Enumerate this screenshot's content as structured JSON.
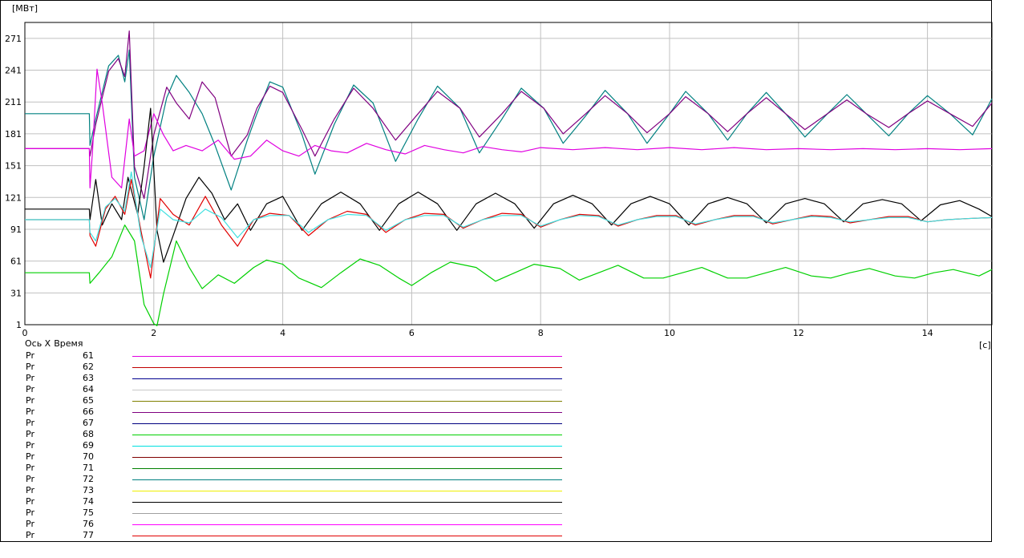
{
  "chart_data": {
    "type": "line",
    "ylabel": "[МВт]",
    "xlabel": "[с]",
    "xlim": [
      0,
      15
    ],
    "ylim": [
      1,
      286
    ],
    "y_ticks": [
      "271",
      "241",
      "211",
      "181",
      "151",
      "121",
      "91",
      "61",
      "31",
      "1"
    ],
    "y_tick_values": [
      271,
      241,
      211,
      181,
      151,
      121,
      91,
      61,
      31,
      1
    ],
    "x_ticks": [
      "0",
      "2",
      "4",
      "6",
      "8",
      "10",
      "12",
      "14"
    ],
    "x_tick_values": [
      0,
      2,
      4,
      6,
      8,
      10,
      12,
      14
    ],
    "grid": true,
    "legend_header": {
      "axis": "Ось X",
      "name": "Время"
    },
    "legend": [
      {
        "var": "Pr",
        "num": "61",
        "color": "#e000e0"
      },
      {
        "var": "Pr",
        "num": "62",
        "color": "#c00000"
      },
      {
        "var": "Pr",
        "num": "63",
        "color": "#000090"
      },
      {
        "var": "Pr",
        "num": "64",
        "color": "#c8c8c8"
      },
      {
        "var": "Pr",
        "num": "65",
        "color": "#808000"
      },
      {
        "var": "Pr",
        "num": "66",
        "color": "#800080"
      },
      {
        "var": "Pr",
        "num": "67",
        "color": "#000080"
      },
      {
        "var": "Pr",
        "num": "68",
        "color": "#00d000"
      },
      {
        "var": "Pr",
        "num": "69",
        "color": "#00e0e0"
      },
      {
        "var": "Pr",
        "num": "70",
        "color": "#800000"
      },
      {
        "var": "Pr",
        "num": "71",
        "color": "#008000"
      },
      {
        "var": "Pr",
        "num": "72",
        "color": "#008080"
      },
      {
        "var": "Pr",
        "num": "73",
        "color": "#f0f000"
      },
      {
        "var": "Pr",
        "num": "74",
        "color": "#000000"
      },
      {
        "var": "Pr",
        "num": "75",
        "color": "#a0a0a0"
      },
      {
        "var": "Pr",
        "num": "76",
        "color": "#ff00ff"
      },
      {
        "var": "Pr",
        "num": "77",
        "color": "#e00000"
      }
    ],
    "series": [
      {
        "color": "#008080",
        "x": [
          0,
          1,
          1.01,
          1.1,
          1.3,
          1.45,
          1.55,
          1.62,
          1.7,
          1.85,
          2.0,
          2.2,
          2.35,
          2.55,
          2.75,
          2.95,
          3.2,
          3.45,
          3.6,
          3.8,
          4.0,
          4.3,
          4.5,
          4.8,
          5.1,
          5.4,
          5.75,
          6.1,
          6.4,
          6.75,
          7.05,
          7.4,
          7.7,
          8.05,
          8.35,
          8.7,
          9.0,
          9.35,
          9.65,
          10.0,
          10.25,
          10.6,
          10.9,
          11.2,
          11.5,
          11.8,
          12.1,
          12.45,
          12.75,
          13.05,
          13.4,
          13.7,
          14.0,
          14.35,
          14.7,
          15.0
        ],
        "y": [
          200,
          200,
          170,
          195,
          245,
          255,
          230,
          260,
          140,
          100,
          160,
          215,
          236,
          220,
          200,
          170,
          128,
          175,
          200,
          230,
          225,
          180,
          143,
          190,
          227,
          210,
          155,
          195,
          226,
          205,
          163,
          195,
          224,
          205,
          172,
          198,
          222,
          200,
          172,
          200,
          221,
          200,
          175,
          200,
          220,
          200,
          178,
          200,
          218,
          200,
          179,
          200,
          217,
          200,
          180,
          214
        ]
      },
      {
        "color": "#800080",
        "x": [
          0,
          1,
          1.01,
          1.1,
          1.3,
          1.45,
          1.55,
          1.62,
          1.7,
          1.85,
          2.0,
          2.2,
          2.35,
          2.55,
          2.75,
          2.95,
          3.2,
          3.45,
          3.6,
          3.8,
          4.0,
          4.3,
          4.5,
          4.8,
          5.1,
          5.4,
          5.75,
          6.1,
          6.4,
          6.75,
          7.05,
          7.4,
          7.7,
          8.05,
          8.35,
          8.7,
          9.0,
          9.35,
          9.65,
          10.0,
          10.25,
          10.6,
          10.9,
          11.2,
          11.5,
          11.8,
          12.1,
          12.45,
          12.75,
          13.05,
          13.4,
          13.7,
          14.0,
          14.35,
          14.7,
          15.0
        ],
        "y": [
          167,
          167,
          160,
          190,
          240,
          252,
          235,
          278,
          150,
          120,
          180,
          225,
          210,
          195,
          230,
          215,
          160,
          180,
          205,
          226,
          220,
          185,
          160,
          195,
          224,
          205,
          175,
          200,
          221,
          205,
          178,
          200,
          221,
          205,
          181,
          200,
          217,
          200,
          182,
          200,
          216,
          200,
          183,
          200,
          215,
          200,
          185,
          200,
          213,
          200,
          187,
          200,
          212,
          200,
          188,
          210
        ]
      },
      {
        "color": "#e000e0",
        "x": [
          0,
          1,
          1.01,
          1.05,
          1.12,
          1.2,
          1.35,
          1.5,
          1.62,
          1.7,
          1.85,
          2.0,
          2.15,
          2.3,
          2.5,
          2.75,
          3.0,
          3.25,
          3.5,
          3.75,
          4.0,
          4.25,
          4.5,
          4.75,
          5.0,
          5.3,
          5.6,
          5.9,
          6.2,
          6.5,
          6.8,
          7.1,
          7.4,
          7.7,
          8.0,
          8.5,
          9.0,
          9.5,
          10.0,
          10.5,
          11.0,
          11.5,
          12.0,
          12.5,
          13.0,
          13.5,
          14.0,
          14.5,
          15.0
        ],
        "y": [
          167,
          167,
          130,
          165,
          242,
          210,
          140,
          130,
          195,
          160,
          165,
          200,
          180,
          165,
          170,
          165,
          175,
          157,
          160,
          175,
          165,
          160,
          170,
          165,
          163,
          172,
          166,
          162,
          170,
          166,
          163,
          169,
          166,
          164,
          168,
          166,
          168,
          166,
          168,
          166,
          168,
          166,
          167,
          166,
          167,
          166,
          167,
          166,
          167
        ]
      },
      {
        "color": "#000000",
        "x": [
          0,
          1,
          1.01,
          1.1,
          1.2,
          1.35,
          1.5,
          1.6,
          1.75,
          1.85,
          1.95,
          2.05,
          2.15,
          2.3,
          2.5,
          2.7,
          2.9,
          3.1,
          3.3,
          3.5,
          3.75,
          4.0,
          4.3,
          4.6,
          4.9,
          5.2,
          5.5,
          5.8,
          6.1,
          6.4,
          6.7,
          7.0,
          7.3,
          7.6,
          7.9,
          8.2,
          8.5,
          8.8,
          9.1,
          9.4,
          9.7,
          10.0,
          10.3,
          10.6,
          10.9,
          11.2,
          11.5,
          11.8,
          12.1,
          12.4,
          12.7,
          13.0,
          13.3,
          13.6,
          13.9,
          14.2,
          14.5,
          14.8,
          15.0
        ],
        "y": [
          110,
          110,
          100,
          138,
          95,
          115,
          100,
          140,
          105,
          150,
          205,
          90,
          60,
          85,
          120,
          140,
          125,
          100,
          115,
          90,
          115,
          122,
          90,
          115,
          126,
          115,
          90,
          115,
          126,
          115,
          90,
          115,
          125,
          115,
          92,
          115,
          123,
          115,
          95,
          115,
          122,
          115,
          95,
          115,
          121,
          115,
          97,
          115,
          120,
          115,
          98,
          115,
          119,
          115,
          99,
          114,
          118,
          110,
          103
        ]
      },
      {
        "color": "#e00000",
        "x": [
          0,
          1,
          1.01,
          1.1,
          1.25,
          1.4,
          1.55,
          1.65,
          1.8,
          1.95,
          2.1,
          2.3,
          2.55,
          2.8,
          3.05,
          3.3,
          3.55,
          3.8,
          4.1,
          4.4,
          4.7,
          5.0,
          5.3,
          5.6,
          5.9,
          6.2,
          6.5,
          6.8,
          7.1,
          7.4,
          7.7,
          8.0,
          8.3,
          8.6,
          8.9,
          9.2,
          9.5,
          9.8,
          10.1,
          10.4,
          10.7,
          11.0,
          11.3,
          11.6,
          11.9,
          12.2,
          12.5,
          12.8,
          13.1,
          13.4,
          13.7,
          14.0,
          14.3,
          14.6,
          15.0
        ],
        "y": [
          100,
          100,
          85,
          75,
          110,
          122,
          105,
          138,
          90,
          45,
          120,
          105,
          95,
          122,
          95,
          75,
          100,
          106,
          104,
          85,
          100,
          108,
          105,
          88,
          100,
          106,
          105,
          92,
          100,
          106,
          105,
          93,
          100,
          105,
          104,
          94,
          100,
          104,
          104,
          95,
          100,
          104,
          104,
          96,
          100,
          104,
          103,
          97,
          100,
          103,
          103,
          98,
          100,
          101,
          102
        ]
      },
      {
        "color": "#40e0e0",
        "x": [
          0,
          1,
          1.01,
          1.1,
          1.25,
          1.4,
          1.55,
          1.65,
          1.8,
          1.95,
          2.1,
          2.3,
          2.55,
          2.8,
          3.05,
          3.3,
          3.55,
          3.8,
          4.1,
          4.4,
          4.7,
          5.0,
          5.3,
          5.6,
          5.9,
          6.2,
          6.5,
          6.8,
          7.1,
          7.4,
          7.7,
          8.0,
          8.3,
          8.6,
          8.9,
          9.2,
          9.5,
          9.8,
          10.1,
          10.4,
          10.7,
          11.0,
          11.3,
          11.6,
          11.9,
          12.2,
          12.5,
          12.8,
          13.1,
          13.4,
          13.7,
          14.0,
          14.3,
          14.6,
          15.0
        ],
        "y": [
          100,
          100,
          88,
          80,
          112,
          120,
          108,
          145,
          85,
          55,
          110,
          100,
          97,
          110,
          102,
          83,
          100,
          104,
          104,
          88,
          100,
          105,
          104,
          90,
          100,
          104,
          104,
          93,
          100,
          104,
          104,
          94,
          100,
          104,
          103,
          95,
          100,
          103,
          103,
          96,
          100,
          103,
          103,
          97,
          100,
          103,
          102,
          98,
          100,
          102,
          102,
          98,
          100,
          101,
          102
        ]
      },
      {
        "color": "#00d000",
        "x": [
          0,
          1,
          1.01,
          1.15,
          1.35,
          1.55,
          1.7,
          1.85,
          2.0,
          2.05,
          2.15,
          2.35,
          2.55,
          2.75,
          3.0,
          3.25,
          3.55,
          3.75,
          4.0,
          4.25,
          4.6,
          4.9,
          5.2,
          5.5,
          5.8,
          6.0,
          6.3,
          6.6,
          7.0,
          7.3,
          7.6,
          7.9,
          8.3,
          8.6,
          8.9,
          9.2,
          9.6,
          9.9,
          10.2,
          10.5,
          10.9,
          11.2,
          11.5,
          11.8,
          12.2,
          12.5,
          12.8,
          13.1,
          13.5,
          13.8,
          14.1,
          14.4,
          14.8,
          15.0
        ],
        "y": [
          50,
          50,
          40,
          50,
          65,
          95,
          80,
          20,
          2,
          0,
          30,
          80,
          55,
          35,
          48,
          40,
          55,
          62,
          58,
          45,
          36,
          50,
          63,
          57,
          45,
          38,
          50,
          60,
          55,
          42,
          50,
          58,
          54,
          43,
          50,
          57,
          45,
          45,
          50,
          55,
          45,
          45,
          50,
          55,
          47,
          45,
          50,
          54,
          47,
          45,
          50,
          53,
          47,
          53
        ]
      }
    ]
  }
}
